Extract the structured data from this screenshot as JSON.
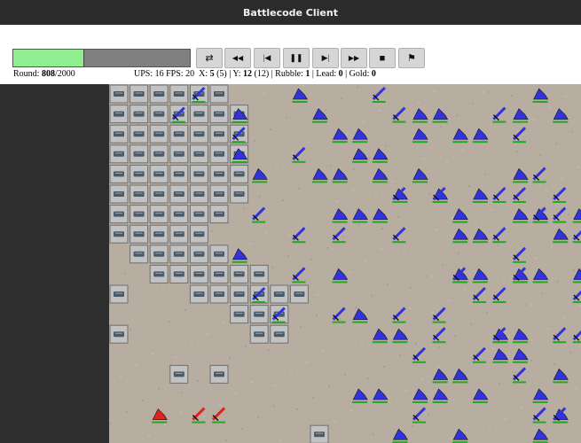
{
  "app": {
    "title": "Battlecode Client"
  },
  "progress": {
    "round": "808",
    "total": "/2000",
    "round_label": "Round: ",
    "fraction": 0.404
  },
  "controls": {
    "icons": [
      "swap-icon",
      "fast-backward-icon",
      "step-backward-icon",
      "pause-icon",
      "step-forward-icon",
      "fast-forward-icon",
      "stop-icon",
      "flag-icon"
    ],
    "glyphs": [
      "⇄",
      "◀◀",
      "|◀",
      "❚❚",
      "▶|",
      "▶▶",
      "■",
      "⚑"
    ]
  },
  "stats": {
    "ups_fps": "UPS: 16 FPS: 20",
    "x_label": "X: ",
    "x_val": "5",
    "x_paren": " (5)",
    "y_label": " | Y: ",
    "y_val": "12",
    "y_paren": " (12)",
    "rubble_label": " | Rubble: ",
    "rubble_val": "1",
    "lead_label": " | Lead: ",
    "lead_val": "0",
    "gold_label": " | Gold: ",
    "gold_val": "0"
  },
  "colors": {
    "blue_team": "#3333dd",
    "red_team": "#dd2222",
    "health_bar": "#22aa22",
    "map_bg": "#b7ada0"
  }
}
